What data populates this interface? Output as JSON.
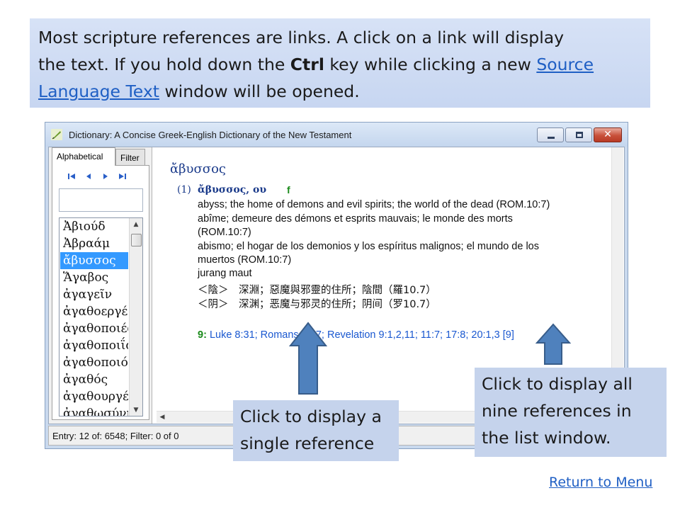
{
  "intro": {
    "line1": "Most scripture references are links. A click on a link will display",
    "line2_prefix": "the text. If you hold down the ",
    "ctrl": "Ctrl",
    "line2_suffix": " key while clicking a new ",
    "link1": "Source",
    "link2": "Language Text",
    "line3_suffix": " window will be opened."
  },
  "window": {
    "title": "Dictionary: A Concise Greek-English Dictionary of the New Testament",
    "close_glyph": "✕",
    "tabs": [
      "Alphabetical",
      "Filter"
    ],
    "nav_icons": [
      "first-icon",
      "prev-icon",
      "next-icon",
      "last-icon"
    ],
    "search_value": "",
    "words": [
      "Ἀβιούδ",
      "Ἀβραάμ",
      "ἄβυσσος",
      "Ἅγαβος",
      "ἀγαγεῖν",
      "ἀγαθοεργέω",
      "ἀγαθοποιέω",
      "ἀγαθοποιΐα",
      "ἀγαθοποιός",
      "ἀγαθός",
      "ἀγαθουργέω",
      "ἀγαθωσύνη"
    ],
    "selected_index": 2,
    "status": "Entry: 12 of: 6548; Filter: 0 of 0"
  },
  "entry": {
    "headword": "ἄβυσσος",
    "number": "(1)",
    "lemma": "ἄβυσσος, ου",
    "gender": "f",
    "definitions": [
      "abyss; the home of demons and evil spirits; the world of the dead (ROM.10:7)",
      "abîme; demeure des démons et esprits mauvais; le monde des morts",
      "(ROM.10:7)",
      "abismo; el hogar de los demonios y los espíritus malignos; el mundo de los",
      "muertos (ROM.10:7)",
      "jurang maut",
      "＜陰＞　深淵；惡魔與邪靈的住所；陰間（羅10.7）",
      "＜阴＞　深渊；恶魔与邪灵的住所；阴间（罗10.7）"
    ],
    "ref_count": "9:",
    "refs": "Luke 8:31; Romans 10:7; Revelation 9:1,2,11; 11:7; 17:8; 20:1,3",
    "refs_all": "[9]"
  },
  "callouts": {
    "single": "Click to display a single reference",
    "all": "Click to display all nine references in the list window."
  },
  "return_link": "Return to Menu",
  "colors": {
    "callout_bg": "#c5d3ec",
    "arrow_fill": "#4f81bd",
    "arrow_stroke": "#385d8a",
    "link": "#1f5fc4"
  }
}
